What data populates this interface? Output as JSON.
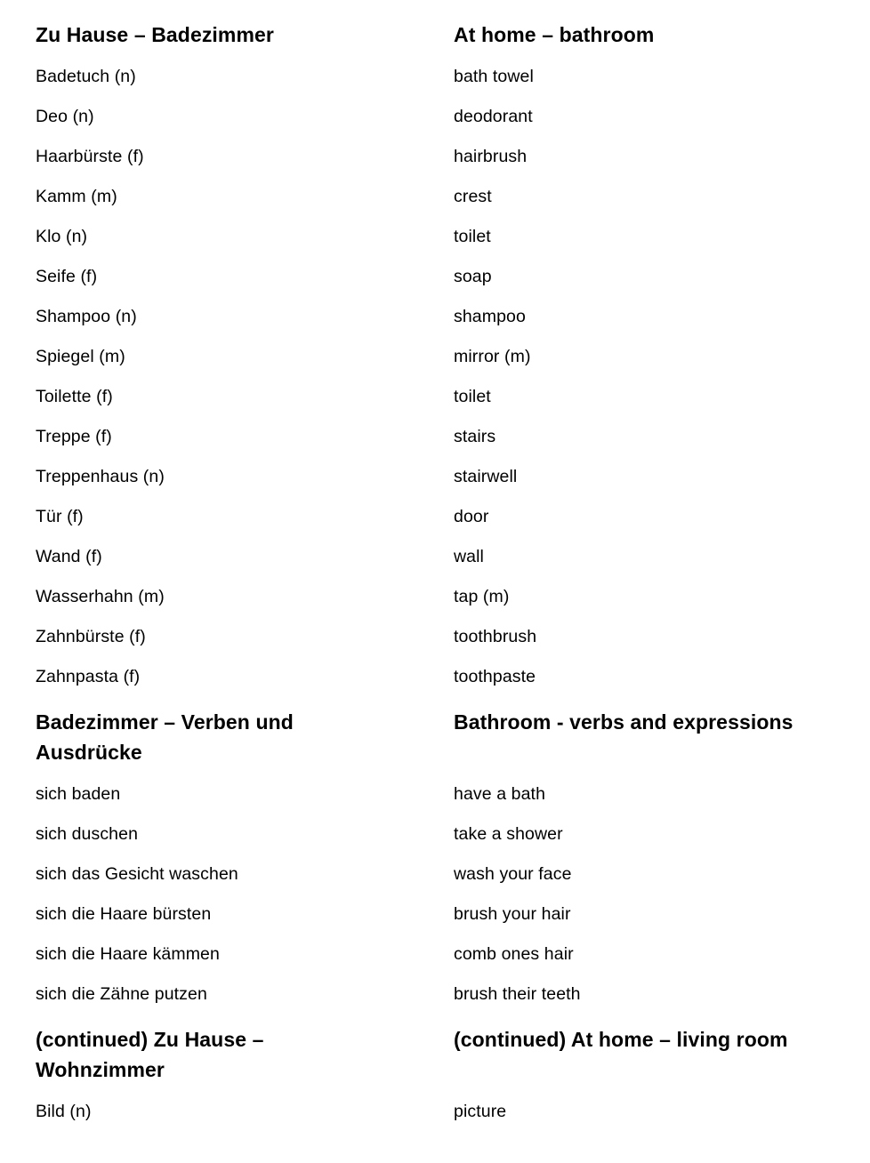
{
  "document": {
    "title": "Zu Hause – Badezimmer",
    "language_left": "German",
    "language_right": "English",
    "background_color": "#ffffff",
    "text_color": "#000000"
  },
  "columns": {
    "left_header": "Zu Hause – Badezimmer",
    "right_header": "At home – bathroom"
  },
  "rows": [
    {
      "type": "heading",
      "de": "Zu Hause – Badezimmer",
      "en": "At home – bathroom",
      "wrap": false
    },
    {
      "type": "entry",
      "de": "Badetuch (n)",
      "en": "bath towel"
    },
    {
      "type": "entry",
      "de": "Deo (n)",
      "en": "deodorant"
    },
    {
      "type": "entry",
      "de": "Haarbürste (f)",
      "en": "hairbrush"
    },
    {
      "type": "entry",
      "de": "Kamm (m)",
      "en": "crest"
    },
    {
      "type": "entry",
      "de": "Klo (n)",
      "en": "toilet"
    },
    {
      "type": "entry",
      "de": "Seife (f)",
      "en": "soap"
    },
    {
      "type": "entry",
      "de": "Shampoo (n)",
      "en": "shampoo"
    },
    {
      "type": "entry",
      "de": "Spiegel (m)",
      "en": "mirror (m)"
    },
    {
      "type": "entry",
      "de": "Toilette (f)",
      "en": "toilet"
    },
    {
      "type": "entry",
      "de": "Treppe (f)",
      "en": "stairs"
    },
    {
      "type": "entry",
      "de": "Treppenhaus (n)",
      "en": "stairwell"
    },
    {
      "type": "entry",
      "de": "Tür (f)",
      "en": "door"
    },
    {
      "type": "entry",
      "de": "Wand (f)",
      "en": "wall"
    },
    {
      "type": "entry",
      "de": "Wasserhahn (m)",
      "en": "tap (m)"
    },
    {
      "type": "entry",
      "de": "Zahnbürste (f)",
      "en": "toothbrush"
    },
    {
      "type": "entry",
      "de": "Zahnpasta (f)",
      "en": "toothpaste"
    },
    {
      "type": "heading",
      "de": "Badezimmer – Verben und Ausdrücke",
      "en": "Bathroom - verbs and expressions",
      "wrap": true
    },
    {
      "type": "entry",
      "de": "sich baden",
      "en": "have a bath"
    },
    {
      "type": "entry",
      "de": "sich duschen",
      "en": "take a shower"
    },
    {
      "type": "entry",
      "de": "sich das Gesicht waschen",
      "en": "wash your face"
    },
    {
      "type": "entry",
      "de": "sich die Haare bürsten",
      "en": "brush your hair"
    },
    {
      "type": "entry",
      "de": "sich die Haare kämmen",
      "en": "comb ones hair"
    },
    {
      "type": "entry",
      "de": "sich die Zähne putzen",
      "en": "brush their teeth"
    },
    {
      "type": "heading",
      "de": "(continued) Zu Hause – Wohnzimmer",
      "en": "(continued) At home – living room",
      "wrap": true
    },
    {
      "type": "entry",
      "de": "Bild (n)",
      "en": "picture"
    }
  ]
}
